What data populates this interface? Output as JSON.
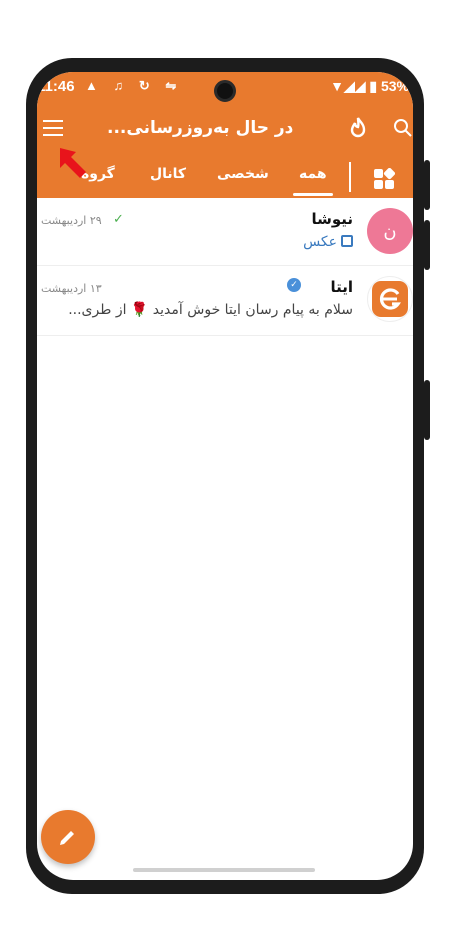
{
  "status_bar": {
    "time": "11:46",
    "battery": "53%"
  },
  "app_bar": {
    "title": "در حال به‌روزرسانی..."
  },
  "tabs": [
    {
      "label": "همه",
      "active": true
    },
    {
      "label": "شخصی",
      "active": false
    },
    {
      "label": "کانال",
      "active": false
    },
    {
      "label": "گروه",
      "active": false
    }
  ],
  "chats": [
    {
      "name": "نیوشا",
      "avatar_letter": "ن",
      "date": "۲۹ اردیبهشت",
      "preview": "عکس",
      "sent_read": true
    },
    {
      "name": "ایتا",
      "verified": true,
      "date": "۱۳ اردیبهشت",
      "preview": "سلام به پیام رسان ایتا خوش آمدید 🌹 از طری..."
    }
  ],
  "colors": {
    "accent": "#e87a2e",
    "avatar_pink": "#ee7896",
    "verified_blue": "#4a90d9"
  }
}
